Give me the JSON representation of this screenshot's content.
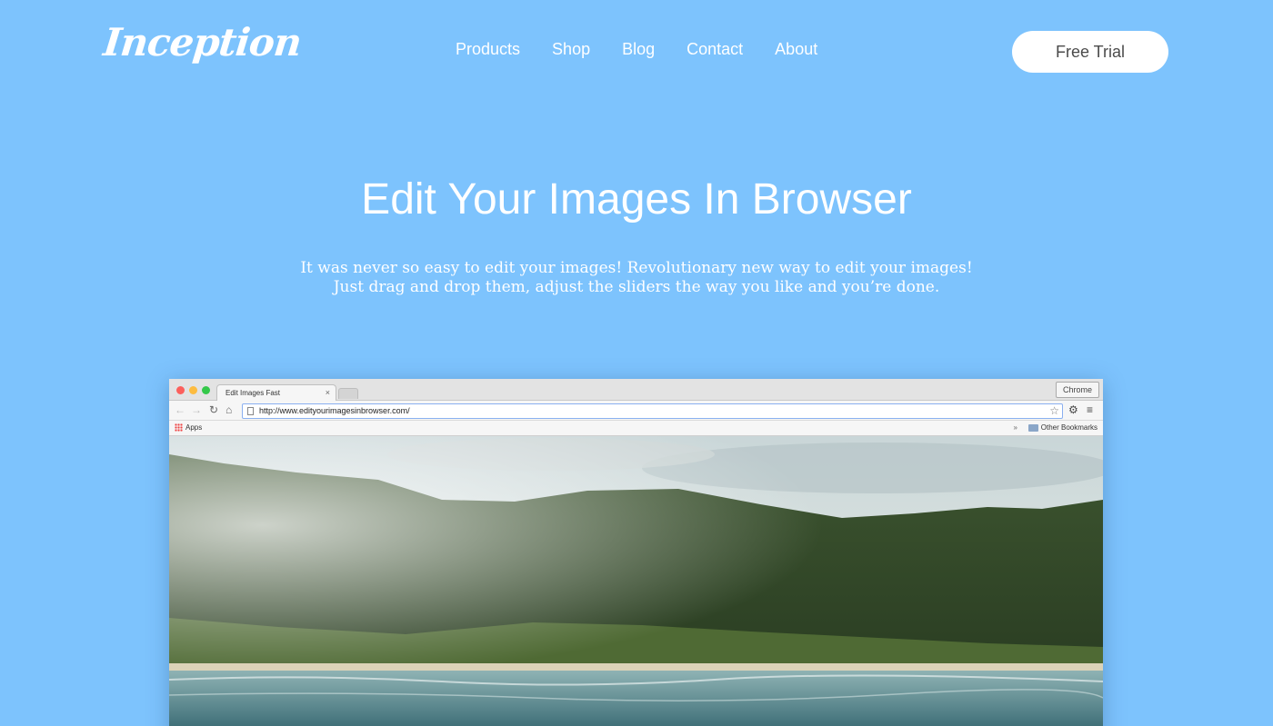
{
  "brand": {
    "logo": "Inception"
  },
  "nav": {
    "items": [
      "Products",
      "Shop",
      "Blog",
      "Contact",
      "About"
    ],
    "cta_label": "Free Trial"
  },
  "hero": {
    "title": "Edit Your Images In Browser",
    "subtitle_line1": "It was never so easy to edit your images! Revolutionary new way to edit your images!",
    "subtitle_line2": "Just drag and drop them, adjust the sliders the way you like and you’re done."
  },
  "browser": {
    "tab_title": "Edit Images Fast",
    "tab_close": "×",
    "profile_label": "Chrome",
    "url": "http://www.edityourimagesinbrowser.com/",
    "bookmarks": {
      "apps_label": "Apps",
      "chevron": "»",
      "other_label": "Other Bookmarks"
    },
    "icons": {
      "back": "←",
      "forward": "→",
      "reload": "↻",
      "home": "⌂",
      "star": "☆",
      "settings": "⚙",
      "menu": "≡"
    }
  },
  "colors": {
    "background": "#7dc3fd",
    "text_on_bg": "#ffffff",
    "cta_bg": "#ffffff",
    "cta_text": "#4b4b4b"
  }
}
